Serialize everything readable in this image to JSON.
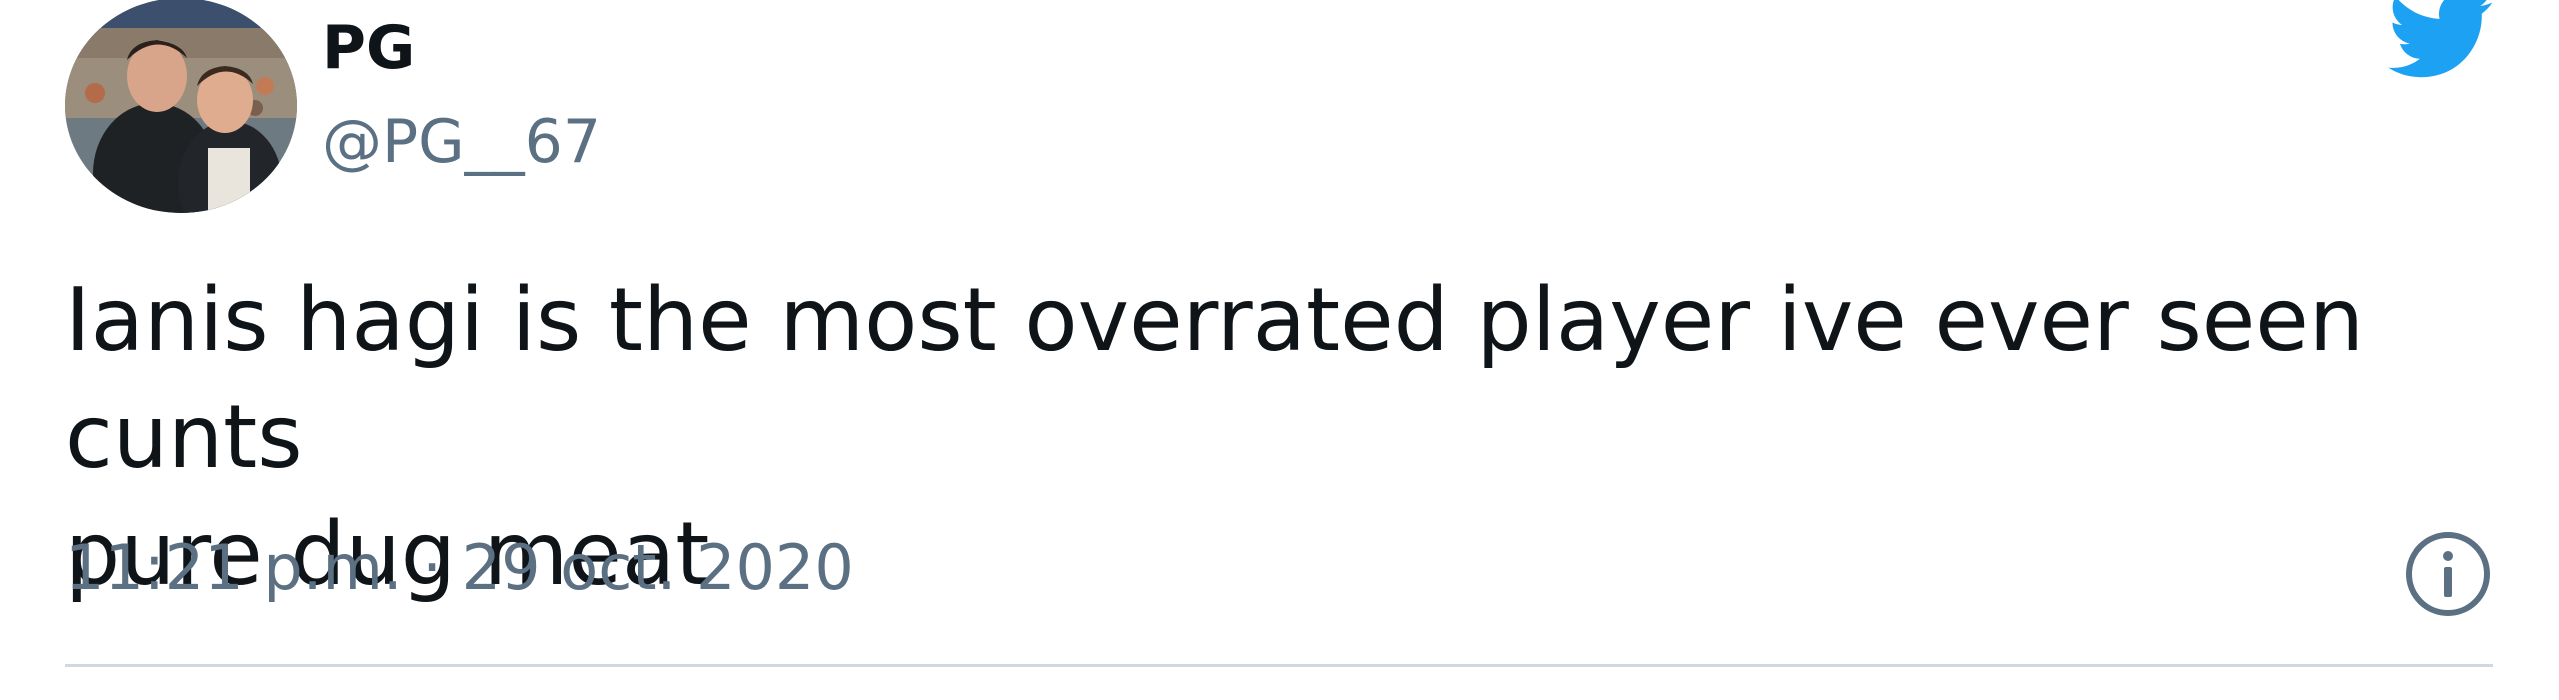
{
  "author": {
    "display_name": "PG",
    "handle": "@PG__67",
    "avatar_icon": "avatar-photo"
  },
  "tweet": {
    "text": "Ianis hagi is the most overrated player ive ever seen cunts\npure dug meat",
    "timestamp": "11:21 p.m. · 29 oct. 2020"
  },
  "icons": {
    "logo": "twitter-bird-icon",
    "info": "info-icon"
  },
  "colors": {
    "twitter_blue": "#1da1f2",
    "text_primary": "#0f1419",
    "text_secondary": "#5b7083",
    "divider": "#cfd9de"
  }
}
